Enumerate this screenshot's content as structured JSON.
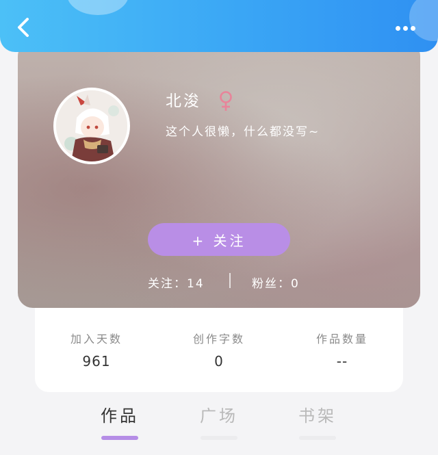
{
  "header": {
    "back_icon": "chevron-left-icon",
    "more_icon": "more-dots-icon",
    "accent_color": "#3aa6f5"
  },
  "profile": {
    "username": "北浚",
    "gender_symbol": "♀",
    "gender_color": "#e8849a",
    "bio": "这个人很懒，什么都没写~",
    "follow_button_label": "+ 关注",
    "follow_button_color": "#b98ee6",
    "following_text": "关注：14",
    "fans_text": "粉丝：0"
  },
  "stats": [
    {
      "label": "加入天数",
      "value": "961"
    },
    {
      "label": "创作字数",
      "value": "0"
    },
    {
      "label": "作品数量",
      "value": "--"
    }
  ],
  "tabs": [
    {
      "label": "作品",
      "active": true
    },
    {
      "label": "广场",
      "active": false
    },
    {
      "label": "书架",
      "active": false
    }
  ]
}
